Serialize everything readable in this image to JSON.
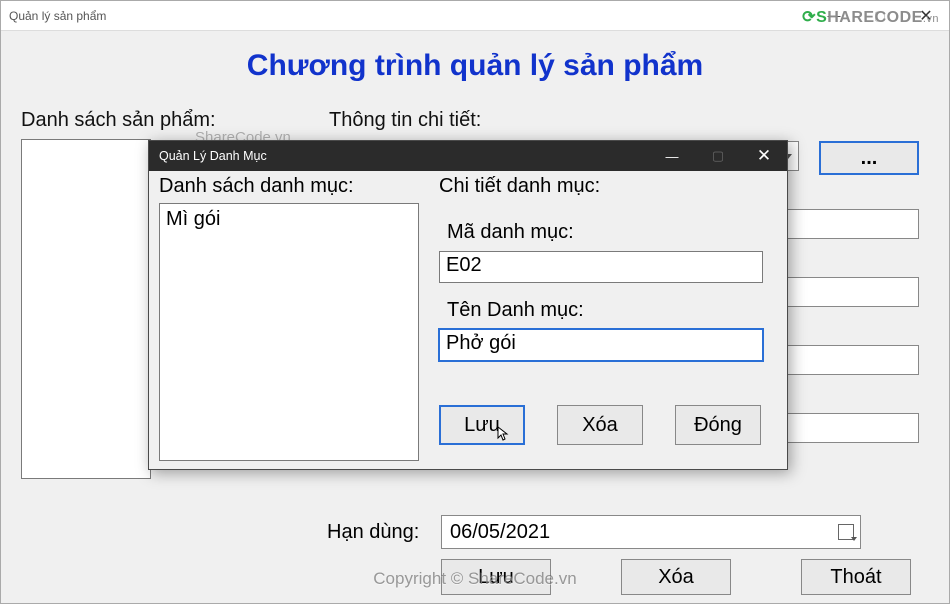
{
  "main_window": {
    "title": "Quản lý sản phẩm",
    "heading": "Chương trình quản lý sản phẩm",
    "labels": {
      "product_list": "Danh sách sản phẩm:",
      "detail_info": "Thông tin chi tiết:",
      "expiry": "Hạn dùng:"
    },
    "ellipsis_button": "...",
    "expiry_value": "06/05/2021",
    "buttons": {
      "save": "Lưu",
      "delete": "Xóa",
      "exit": "Thoát"
    }
  },
  "dialog": {
    "title": "Quản Lý Danh Mục",
    "labels": {
      "list": "Danh sách danh mục:",
      "detail": "Chi tiết danh mục:",
      "code": "Mã danh mục:",
      "name": "Tên Danh mục:"
    },
    "list_items": [
      "Mì gói"
    ],
    "fields": {
      "code": "E02",
      "name": "Phở gói"
    },
    "buttons": {
      "save": "Lưu",
      "delete": "Xóa",
      "close": "Đóng"
    }
  },
  "watermarks": {
    "top": "ShareCode.vn",
    "mid": "ShareCode.vn",
    "bottom": "Copyright © ShareCode.vn",
    "logo_word": "SHARECODE",
    "logo_tail": ".vn"
  }
}
